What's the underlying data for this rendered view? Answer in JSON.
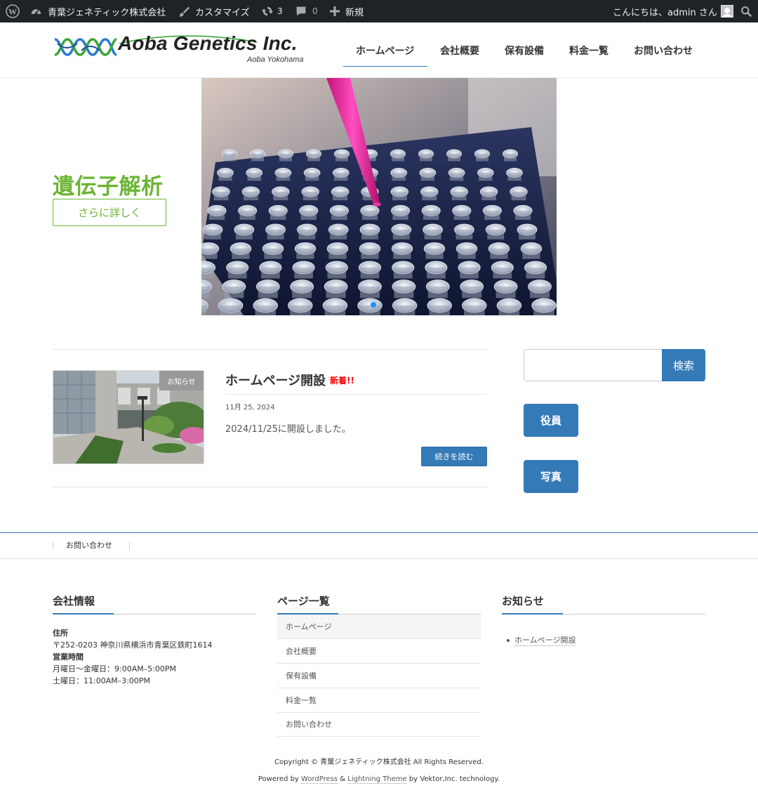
{
  "admin_bar": {
    "site_name": "青葉ジェネティック株式会社",
    "customize": "カスタマイズ",
    "updates_count": "3",
    "comments_count": "0",
    "new_label": "新規",
    "greeting": "こんにちは、admin さん"
  },
  "header": {
    "logo_text": "Aoba Genetics Inc.",
    "logo_sub": "Aoba Yokohama",
    "nav": [
      "ホームページ",
      "会社概要",
      "保有設備",
      "料金一覧",
      "お問い合わせ"
    ],
    "active_nav_index": 0
  },
  "slider": {
    "title": "遺伝子解析",
    "button": "さらに詳しく",
    "slide_count": 1,
    "active_slide": 1,
    "accent_color": "#6bb534"
  },
  "post": {
    "category": "お知らせ",
    "title": "ホームページ開設",
    "badge": "新着!!",
    "date": "11月 25, 2024",
    "excerpt": "2024/11/25に開設しました。",
    "read_more": "続きを読む"
  },
  "sidebar": {
    "search_placeholder": "",
    "search_button": "検索",
    "buttons": [
      "役員",
      "写真"
    ]
  },
  "footer_nav": {
    "links": [
      "お問い合わせ"
    ]
  },
  "footer": {
    "company": {
      "title": "会社情報",
      "address_label": "住所",
      "address": "〒252-0203 神奈川県横浜市青葉区鉄町1614",
      "hours_label": "営業時間",
      "weekdays": "月曜日〜金曜日：9:00AM–5:00PM",
      "saturday": "土曜日：11:00AM–3:00PM"
    },
    "pages": {
      "title": "ページ一覧",
      "items": [
        "ホームページ",
        "会社概要",
        "保有設備",
        "料金一覧",
        "お問い合わせ"
      ]
    },
    "news": {
      "title": "お知らせ",
      "items": [
        "ホームページ開設"
      ]
    },
    "copyright": "Copyright © 青葉ジェネティック株式会社 All Rights Reserved.",
    "powered_by": "Powered by",
    "wordpress": "WordPress",
    "amp": "&",
    "theme": "Lightning Theme",
    "by": "by Vektor,Inc. technology."
  },
  "colors": {
    "primary": "#337ab7",
    "green": "#6bb534",
    "new_badge": "#ff0000",
    "admin_bar": "#1d2327"
  }
}
